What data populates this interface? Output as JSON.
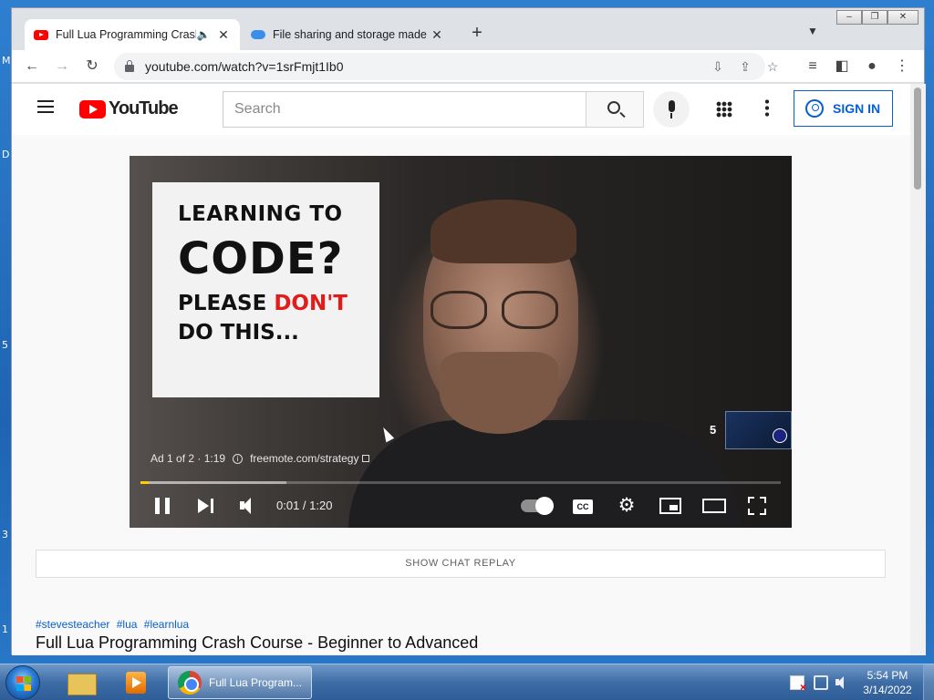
{
  "desktop": {
    "edge_letters": [
      "M",
      "D",
      "5",
      "3",
      "1"
    ]
  },
  "browser": {
    "tabs": [
      {
        "title": "Full Lua Programming Crash",
        "icon": "youtube-icon",
        "active": true
      },
      {
        "title": "File sharing and storage made si",
        "icon": "cloud-icon",
        "active": false
      }
    ],
    "new_tab": "+",
    "url": "youtube.com/watch?v=1srFmjt1Ib0"
  },
  "youtube": {
    "logo_text": "YouTube",
    "search_placeholder": "Search",
    "sign_in": "SIGN IN"
  },
  "player": {
    "thumbnail": {
      "line1": "LEARNING TO",
      "line2": "CODE?",
      "line3a": "PLEASE ",
      "line3b": "DON'T",
      "line4": "DO THIS..."
    },
    "ad_label": "Ad 1 of 2 · 1:19",
    "ad_url": "freemote.com/strategy",
    "skip_countdown": "5",
    "time": "0:01 / 1:20",
    "progress_fraction": 0.0125,
    "cc_label": "CC",
    "progress_color": "#ffcc00"
  },
  "page": {
    "chat_replay": "SHOW CHAT REPLAY",
    "hashtags": [
      "#stevesteacher",
      "#lua",
      "#learnlua"
    ],
    "video_title": "Full Lua Programming Crash Course - Beginner to Advanced"
  },
  "taskbar": {
    "chrome_task_label": "Full Lua Program...",
    "time": "5:54 PM",
    "date": "3/14/2022"
  }
}
